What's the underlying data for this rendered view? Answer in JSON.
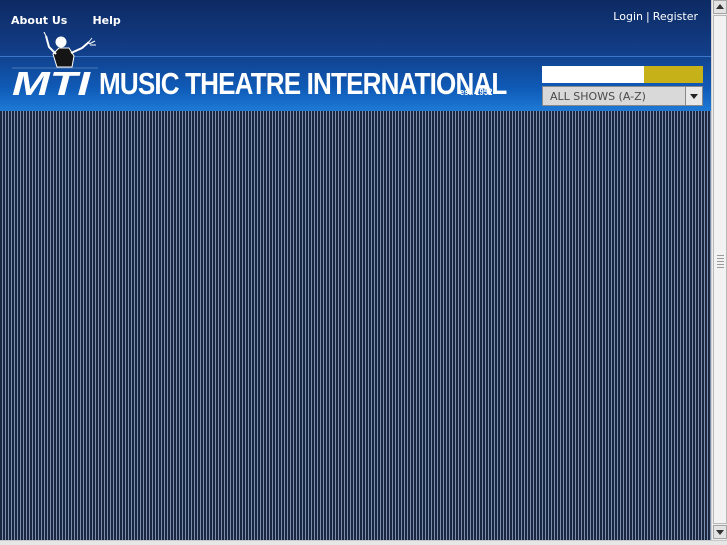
{
  "topnav": {
    "about_label": "About Us",
    "help_label": "Help"
  },
  "account": {
    "login_label": "Login",
    "separator": "|",
    "register_label": "Register"
  },
  "brand": {
    "logo_text": "MTI",
    "name": "MUSIC THEATRE INTERNATIONAL",
    "est": "est. 1952"
  },
  "search": {
    "value": "",
    "button_color": "#c7b119"
  },
  "shows_select": {
    "selected": "ALL SHOWS (A-Z)"
  },
  "icons": {
    "logo": "conductor-logo-icon",
    "select_arrow": "chevron-down-icon",
    "scroll_up": "arrow-up-icon",
    "scroll_down": "arrow-down-icon"
  },
  "colors": {
    "header_top": "#0d2a63",
    "header_bottom": "#1e7ad6",
    "content_dark": "#1b2740",
    "content_stripe": "#7d8fb0",
    "accent_gold": "#c7b119"
  }
}
